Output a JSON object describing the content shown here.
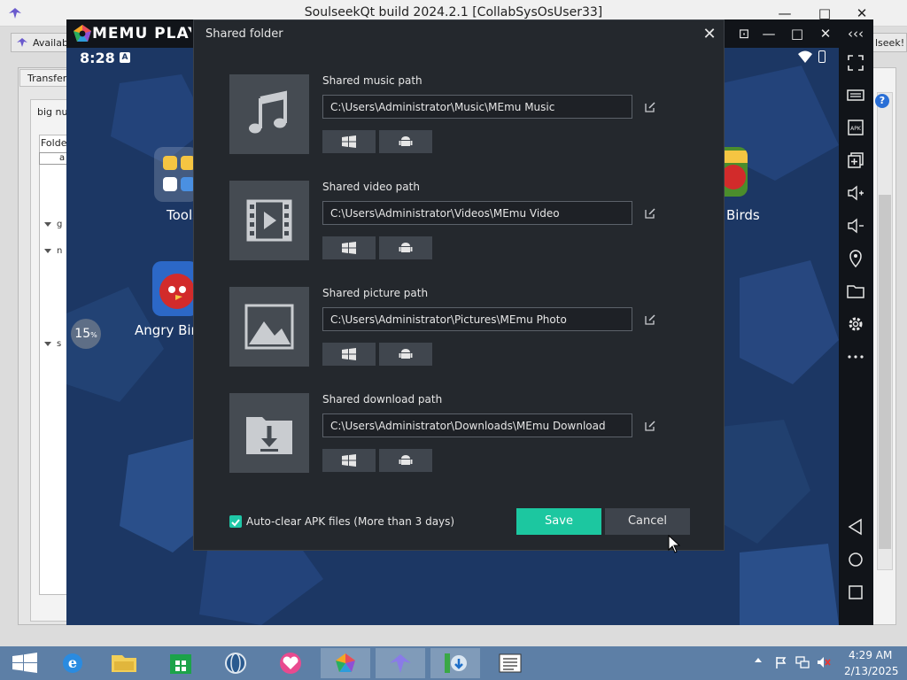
{
  "soulseek": {
    "title": "SoulseekQt build 2024.2.1 [CollabSysOsUser33]",
    "available_btn": "Available",
    "right_btn": "lseek!",
    "tab_transfers": "Transfers",
    "search_text": "big nu",
    "folder_header": "Folde",
    "folder_selected": "a",
    "tree_items": [
      "g",
      "n",
      "s"
    ],
    "help": "?"
  },
  "memu": {
    "brand": "MEMU PLAY",
    "status_time": "8:28",
    "status_a": "A",
    "desktop": {
      "tools_label": "Tools",
      "angry_label": "Angry Birds",
      "angry_right_label": "Birds",
      "progress_value": "15",
      "progress_unit": "%"
    }
  },
  "dialog": {
    "title": "Shared folder",
    "rows": [
      {
        "label": "Shared music path",
        "path": "C:\\Users\\Administrator\\Music\\MEmu Music"
      },
      {
        "label": "Shared video path",
        "path": "C:\\Users\\Administrator\\Videos\\MEmu Video"
      },
      {
        "label": "Shared picture path",
        "path": "C:\\Users\\Administrator\\Pictures\\MEmu Photo"
      },
      {
        "label": "Shared download path",
        "path": "C:\\Users\\Administrator\\Downloads\\MEmu Download"
      }
    ],
    "auto_clear": {
      "label": "Auto-clear APK files (More than 3 days)",
      "checked": true
    },
    "save_label": "Save",
    "cancel_label": "Cancel"
  },
  "taskbar": {
    "clock_time": "4:29 AM",
    "clock_date": "2/13/2025"
  },
  "colors": {
    "accent": "#1cc7a0",
    "dialog_bg": "#24282d",
    "android_bg": "#1c3764"
  }
}
